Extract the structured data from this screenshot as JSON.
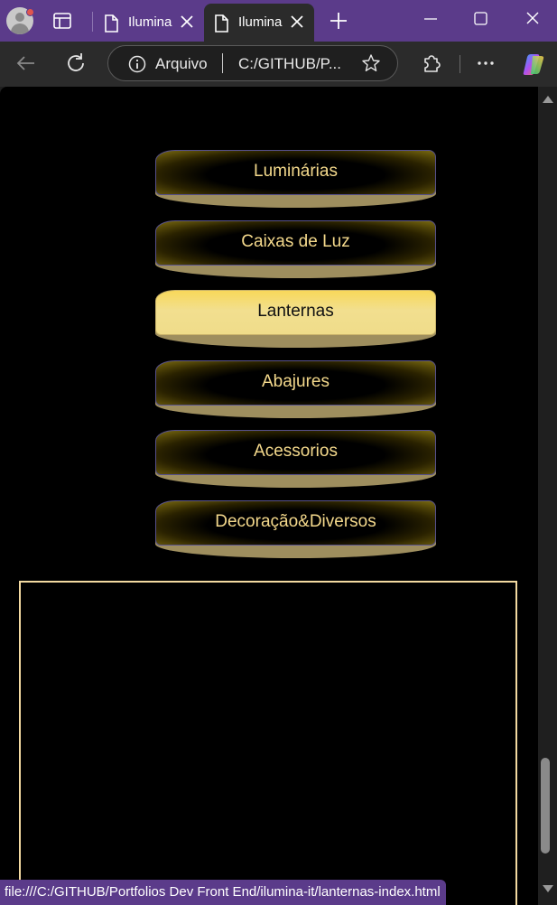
{
  "browser": {
    "tabs": [
      {
        "label": "Ilumina",
        "active": false
      },
      {
        "label": "Ilumina",
        "active": true
      }
    ],
    "address": {
      "scheme_label": "Arquivo",
      "url": "C:/GITHUB/P..."
    },
    "accent_color": "#5b3b8a"
  },
  "page": {
    "menu": [
      {
        "label": "Luminárias",
        "active": false
      },
      {
        "label": "Caixas de Luz",
        "active": false
      },
      {
        "label": "Lanternas",
        "active": true
      },
      {
        "label": "Abajures",
        "active": false
      },
      {
        "label": "Acessorios",
        "active": false
      },
      {
        "label": "Decoração&Diversos",
        "active": false
      }
    ],
    "colors": {
      "background": "#000000",
      "menu_text": "#f4d98c",
      "active_fill": "#f2df8f",
      "frame_border": "#f2d9a0"
    }
  },
  "status_bar": {
    "text": "file:///C:/GITHUB/Portfolios Dev Front End/ilumina-it/lanternas-index.html"
  }
}
